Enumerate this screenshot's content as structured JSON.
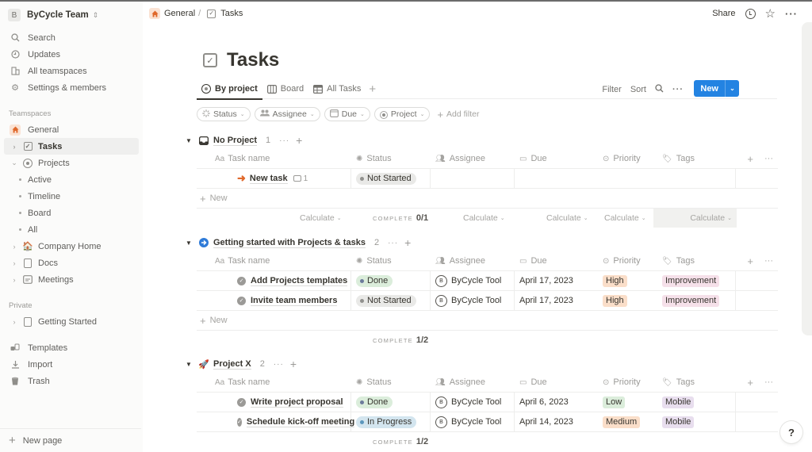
{
  "workspace": {
    "initial": "B",
    "name": "ByCycle Team"
  },
  "sidebar": {
    "nav": [
      {
        "label": "Search",
        "icon": "search-icon"
      },
      {
        "label": "Updates",
        "icon": "clock-icon"
      },
      {
        "label": "All teamspaces",
        "icon": "building-icon"
      },
      {
        "label": "Settings & members",
        "icon": "gear-icon"
      }
    ],
    "teamspaces_label": "Teamspaces",
    "teamspace_name": "General",
    "pages": [
      {
        "label": "Tasks",
        "icon": "checkbox-icon",
        "active": true
      },
      {
        "label": "Projects",
        "icon": "target-icon",
        "expanded": true
      }
    ],
    "project_views": [
      "Active",
      "Timeline",
      "Board",
      "All"
    ],
    "more_pages": [
      {
        "label": "Company Home",
        "icon": "house-emoji-icon"
      },
      {
        "label": "Docs",
        "icon": "doc-icon"
      },
      {
        "label": "Meetings",
        "icon": "calendar-icon"
      }
    ],
    "private_label": "Private",
    "private_pages": [
      {
        "label": "Getting Started",
        "icon": "page-icon"
      }
    ],
    "footer": [
      {
        "label": "Templates",
        "icon": "templates-icon"
      },
      {
        "label": "Import",
        "icon": "import-icon"
      },
      {
        "label": "Trash",
        "icon": "trash-icon"
      }
    ],
    "new_page": "New page"
  },
  "topbar": {
    "breadcrumb": [
      "General",
      "Tasks"
    ],
    "share": "Share"
  },
  "page": {
    "title": "Tasks",
    "views": [
      {
        "label": "By project",
        "active": true
      },
      {
        "label": "Board"
      },
      {
        "label": "All Tasks"
      }
    ],
    "toolbar": {
      "filter": "Filter",
      "sort": "Sort",
      "new": "New"
    },
    "filters": [
      "Status",
      "Assignee",
      "Due",
      "Project"
    ],
    "add_filter": "Add filter"
  },
  "columns": {
    "name": "Task name",
    "name_prefix": "Aa",
    "status": "Status",
    "assignee": "Assignee",
    "due": "Due",
    "priority": "Priority",
    "tags": "Tags"
  },
  "colors": {
    "accent": "#2383e2",
    "status": {
      "Not Started": "#e9e9e7",
      "Done": "#dbeddb",
      "In Progress": "#d3e5ef"
    },
    "status_dot": {
      "Not Started": "#91918e",
      "Done": "#6c9b7d",
      "In Progress": "#5b97bd"
    },
    "priority": {
      "High": "#fadec9",
      "Medium": "#fadec9",
      "Low": "#dbeddb"
    },
    "tags": {
      "Improvement": "#f5e0e9",
      "Mobile": "#e8deee"
    }
  },
  "groups": [
    {
      "name": "No Project",
      "count": "1",
      "icon": "inbox-icon",
      "tasks": [
        {
          "name": "New task",
          "icon": "arrow-icon",
          "comments": "1",
          "status": "Not Started",
          "assignee": "",
          "due": "",
          "priority": "",
          "tags": ""
        }
      ],
      "new_label": "New",
      "calc": {
        "calc_label": "Calculate",
        "complete_label": "COMPLETE",
        "complete_value": "0/1"
      }
    },
    {
      "name": "Getting started with Projects & tasks",
      "count": "2",
      "icon": "blue-arrow-circle-icon",
      "tasks": [
        {
          "name": "Add Projects templates",
          "status": "Done",
          "assignee": "ByCycle Tool",
          "assignee_initial": "B",
          "due": "April 17, 2023",
          "priority": "High",
          "tags": "Improvement"
        },
        {
          "name": "Invite team members",
          "status": "Not Started",
          "assignee": "ByCycle Tool",
          "assignee_initial": "B",
          "due": "April 17, 2023",
          "priority": "High",
          "tags": "Improvement"
        }
      ],
      "new_label": "New",
      "calc": {
        "complete_label": "COMPLETE",
        "complete_value": "1/2"
      }
    },
    {
      "name": "Project X",
      "count": "2",
      "icon": "rocket-icon",
      "tasks": [
        {
          "name": "Write project proposal",
          "status": "Done",
          "assignee": "ByCycle Tool",
          "assignee_initial": "B",
          "due": "April 6, 2023",
          "priority": "Low",
          "tags": "Mobile"
        },
        {
          "name": "Schedule kick-off meeting",
          "status": "In Progress",
          "assignee": "ByCycle Tool",
          "assignee_initial": "B",
          "due": "April 14, 2023",
          "priority": "Medium",
          "tags": "Mobile"
        }
      ],
      "calc": {
        "complete_label": "COMPLETE",
        "complete_value": "1/2"
      }
    }
  ],
  "help": "?"
}
